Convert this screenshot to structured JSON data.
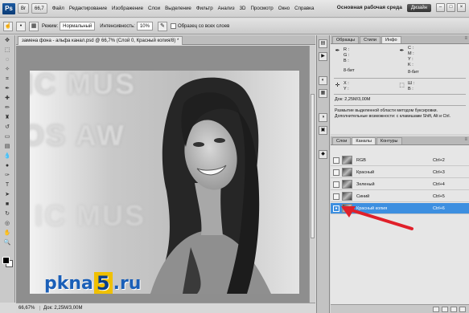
{
  "menubar": {
    "app_logo": "Ps",
    "items": [
      "Файл",
      "Редактирование",
      "Изображение",
      "Слои",
      "Выделение",
      "Фильтр",
      "Анализ",
      "3D",
      "Просмотр",
      "Окно",
      "Справка"
    ],
    "zoom": "66,7",
    "workspace_label": "Основная рабочая среда",
    "design_button": "Дизайн"
  },
  "optbar": {
    "mode_label": "Режим:",
    "mode_value": "Нормальный",
    "intensity_label": "Интенсивность:",
    "intensity_value": "10%",
    "sample_all_label": "Образец со всех слоев"
  },
  "document": {
    "tab_title": "замена фона - альфа канал.psd @ 66,7% (Слой 0, Красный копия/8) *",
    "status_zoom": "66,67%",
    "status_doc": "Док: 2,25M/3,00M",
    "watermark_prefix": "pkna",
    "watermark_five": "5",
    "watermark_suffix": ".ru"
  },
  "info_panel": {
    "tabs": [
      "Образцы",
      "Стили",
      "Инфо"
    ],
    "active_tab": "Инфо",
    "r": "R :",
    "g": "G :",
    "b": "B :",
    "c": "C :",
    "m": "M :",
    "y": "Y :",
    "k": "K :",
    "bit_left": "8-бит",
    "bit_right": "8-бит",
    "x": "X :",
    "y_coord": "Y :",
    "w": "Ш :",
    "h": "В :",
    "doc": "Док: 2,25M/3,00M",
    "desc1": "Размытие выделенной области методом буксировки.",
    "desc2": "Дополнительные возможности: с клавишами Shift, Alt и Ctrl."
  },
  "channels_panel": {
    "tabs": [
      "Слои",
      "Каналы",
      "Контуры"
    ],
    "active_tab": "Каналы",
    "rows": [
      {
        "name": "RGB",
        "key": "Ctrl+2"
      },
      {
        "name": "Красный",
        "key": "Ctrl+3"
      },
      {
        "name": "Зеленый",
        "key": "Ctrl+4"
      },
      {
        "name": "Синий",
        "key": "Ctrl+5"
      },
      {
        "name": "Красный копия",
        "key": "Ctrl+6"
      }
    ]
  },
  "colors": {
    "selected_channel": "#3d8fe0",
    "arrow": "#e0202a",
    "watermark_blue": "#1a5fb8",
    "watermark_yellow": "#f0c000"
  }
}
